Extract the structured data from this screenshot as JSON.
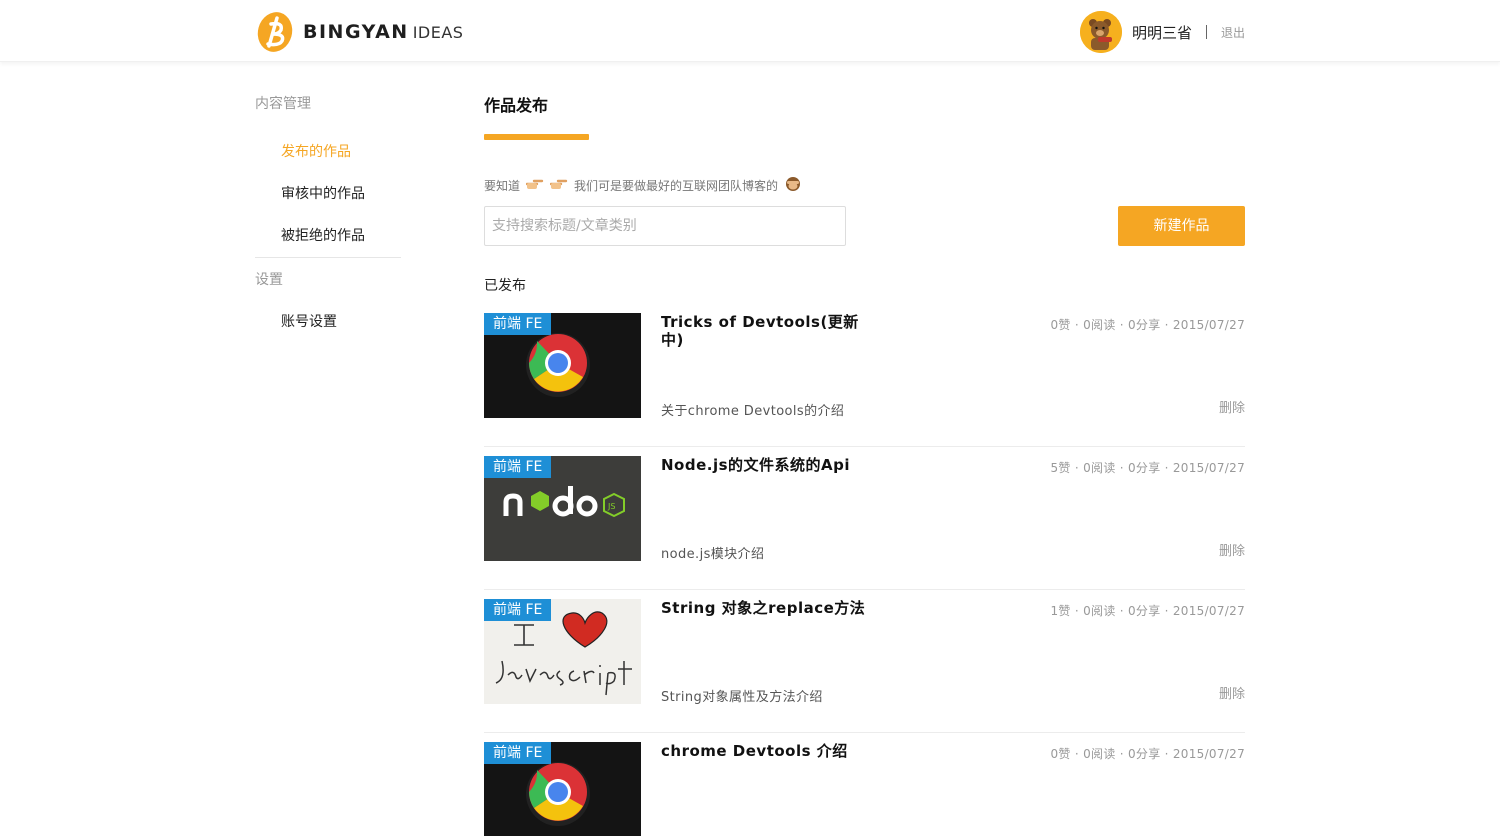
{
  "header": {
    "logo_main": "BINGYAN",
    "logo_sub": "IDEAS",
    "user_name": "明明三省",
    "logout": "退出"
  },
  "sidebar": {
    "content_head": "内容管理",
    "items": [
      {
        "label": "发布的作品",
        "active": true
      },
      {
        "label": "审核中的作品",
        "active": false
      },
      {
        "label": "被拒绝的作品",
        "active": false
      }
    ],
    "settings_head": "设置",
    "settings_items": [
      {
        "label": "账号设置"
      }
    ]
  },
  "main": {
    "title": "作品发布",
    "hint_prefix": "要知道",
    "hint_text": "我们可是要做最好的互联网团队博客的",
    "search_placeholder": "支持搜索标题/文章类别",
    "new_button": "新建作品",
    "section_label": "已发布",
    "accent_color": "#f5a623",
    "tag_color": "#1e8fd6"
  },
  "posts": [
    {
      "tag": "前端 FE",
      "title": "Tricks of Devtools(更新中)",
      "desc": "关于chrome Devtools的介绍",
      "meta": "0赞 · 0阅读 · 0分享 · 2015/07/27",
      "delete": "删除",
      "thumb": "chrome-logo-icon"
    },
    {
      "tag": "前端 FE",
      "title": "Node.js的文件系统的Api",
      "desc": "node.js模块介绍",
      "meta": "5赞 · 0阅读 · 0分享 · 2015/07/27",
      "delete": "删除",
      "thumb": "nodejs-logo-icon"
    },
    {
      "tag": "前端 FE",
      "title": "String 对象之replace方法",
      "desc": "String对象属性及方法介绍",
      "meta": "1赞 · 0阅读 · 0分享 · 2015/07/27",
      "delete": "删除",
      "thumb": "i-love-javascript-image"
    },
    {
      "tag": "前端 FE",
      "title": "chrome Devtools 介绍",
      "desc": "",
      "meta": "0赞 · 0阅读 · 0分享 · 2015/07/27",
      "delete": "",
      "thumb": "chrome-logo-icon"
    }
  ]
}
